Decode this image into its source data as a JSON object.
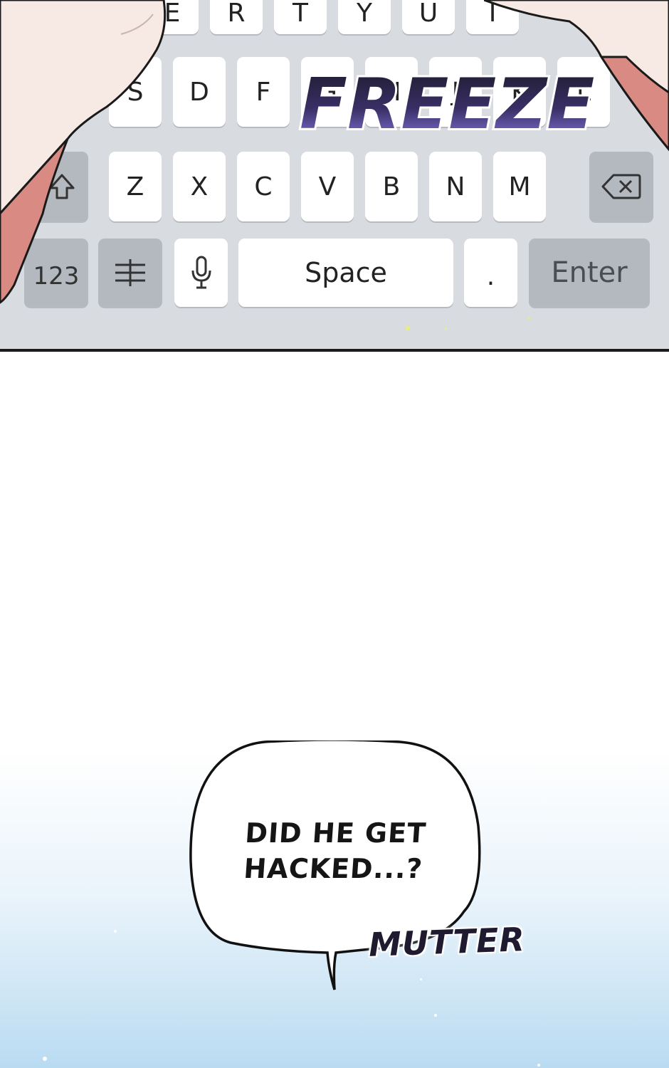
{
  "keyboard": {
    "top_row_partial": [
      "E",
      "R",
      "T",
      "Y",
      "U",
      "I"
    ],
    "home_row": [
      "S",
      "D",
      "F",
      "G",
      "H",
      "J",
      "K",
      "L"
    ],
    "bottom_row": [
      "Z",
      "X",
      "C",
      "V",
      "B",
      "N",
      "M"
    ],
    "shift_icon": "shift-arrow-icon",
    "backspace_icon": "backspace-icon",
    "numbers_label": "123",
    "settings_icon": "keyboard-settings-icon",
    "mic_icon": "microphone-icon",
    "space_label": "Space",
    "period_label": ".",
    "enter_label": "Enter"
  },
  "sfx": {
    "freeze": "FREEZE",
    "mutter": "MUTTER"
  },
  "speech_bubble": {
    "line1": "DID HE GET",
    "line2": "HACKED...?"
  },
  "colors": {
    "keyboard_bg": "#d8dbe0",
    "key_white": "#ffffff",
    "key_gray": "#b4b8bf",
    "freeze_purple": "#6d5bd0",
    "sky_blue": "#b9dbf2"
  }
}
